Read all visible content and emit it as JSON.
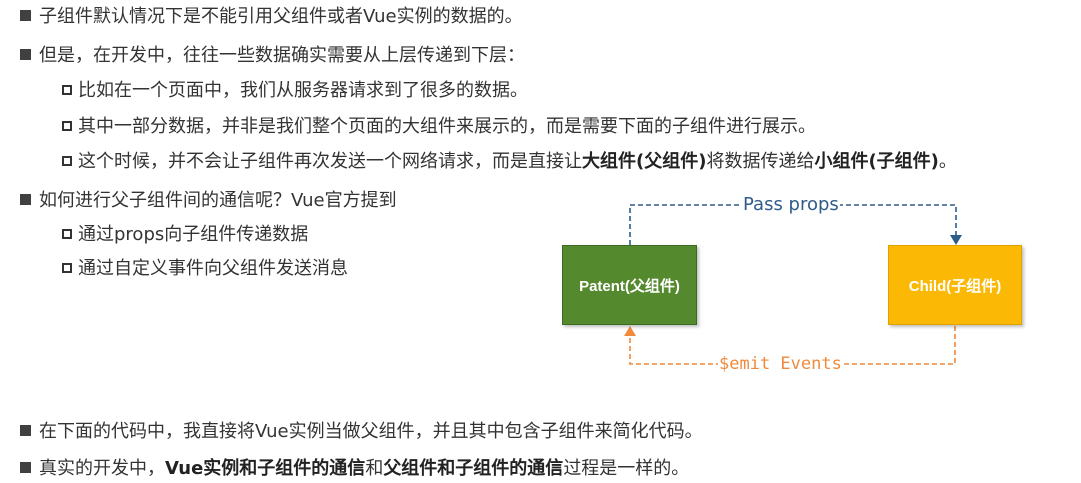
{
  "lines": {
    "b1": "子组件默认情况下是不能引用父组件或者Vue实例的数据的。",
    "b2": "但是，在开发中，往往一些数据确实需要从上层传递到下层：",
    "b2_1": "比如在一个页面中，我们从服务器请求到了很多的数据。",
    "b2_2": "其中一部分数据，并非是我们整个页面的大组件来展示的，而是需要下面的子组件进行展示。",
    "b2_3_pre": "这个时候，并不会让子组件再次发送一个网络请求，而是直接让",
    "b2_3_bold1": "大组件(父组件)",
    "b2_3_mid": "将数据传递给",
    "b2_3_bold2": "小组件(子组件)",
    "b2_3_end": "。",
    "b3": "如何进行父子组件间的通信呢？Vue官方提到",
    "b3_1": "通过props向子组件传递数据",
    "b3_2": "通过自定义事件向父组件发送消息",
    "b4": "在下面的代码中，我直接将Vue实例当做父组件，并且其中包含子组件来简化代码。",
    "b5_pre": "真实的开发中，",
    "b5_bold1": "Vue实例和子组件的通信",
    "b5_mid": "和",
    "b5_bold2": "父组件和子组件的通信",
    "b5_end": "过程是一样的。"
  },
  "diagram": {
    "parent_label": "Patent(父组件)",
    "child_label": "Child(子组件)",
    "props_label": "Pass props",
    "emit_label": "$emit Events",
    "colors": {
      "parent_fill": "#55892e",
      "child_fill": "#fbb804",
      "props_line": "#2d5b8a",
      "emit_line": "#f08a3c"
    }
  }
}
